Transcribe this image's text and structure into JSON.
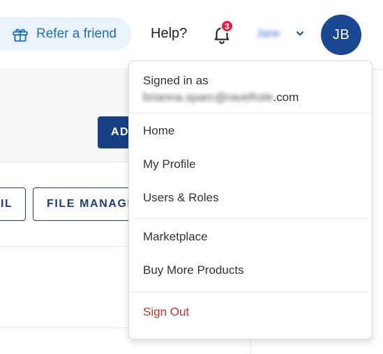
{
  "header": {
    "refer_label": "Refer a friend",
    "help_label": "Help?",
    "notifications_count": "3",
    "user_name": "Jane",
    "avatar_initials": "JB"
  },
  "page": {
    "add_button_label": "AD",
    "tab_email_label": "IL",
    "tab_file_manager_label": "FILE MANAGE"
  },
  "menu": {
    "signed_in_label": "Signed in as",
    "email_obscured": "brianna.sparc@ravefrole",
    "email_domain": ".com",
    "items": [
      "Home",
      "My Profile",
      "Users & Roles",
      "Marketplace",
      "Buy More Products"
    ],
    "sign_out_label": "Sign Out"
  },
  "colors": {
    "accent": "#1a4791",
    "refer_bg": "#eaf2fb",
    "refer_text": "#1f6fc4",
    "badge": "#e11d48",
    "sign_out": "#d32f2f"
  },
  "icons": [
    "gift-icon",
    "bell-icon",
    "chevron-down-icon"
  ]
}
